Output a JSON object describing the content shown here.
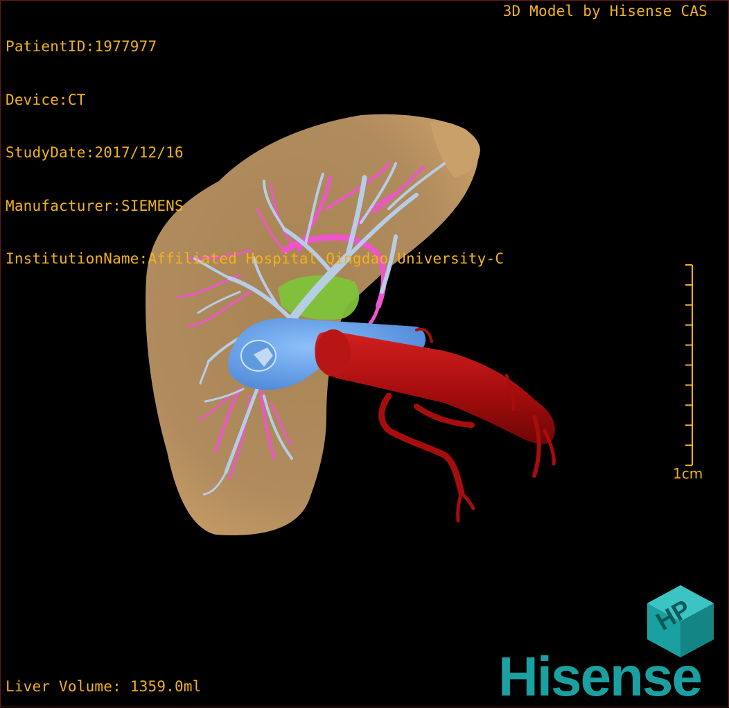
{
  "patient_info": {
    "patient_id": "PatientID:1977977",
    "device": "Device:CT",
    "study_date": "StudyDate:2017/12/16",
    "manufacturer": "Manufacturer:SIEMENS",
    "institution": "InstitutionName:Affiliated Hospital Qingdao University-C"
  },
  "model_credit": "3D Model by Hisense CAS",
  "liver_volume": "Liver Volume: 1359.0ml",
  "scale_bar": {
    "label": "1cm",
    "tick_count": 10
  },
  "brand": {
    "name": "Hisense",
    "logo_glyph": "HP",
    "color": "#1aa0a0"
  },
  "colors": {
    "overlay_text": "#f2b21c",
    "liver": "#b08b5e",
    "portal_vein": "#b7cde6",
    "hepatic_vein": "#ee55cc",
    "gallbladder": "#7fc23a",
    "ivc": "#6aa8ee",
    "aorta": "#b01010"
  }
}
